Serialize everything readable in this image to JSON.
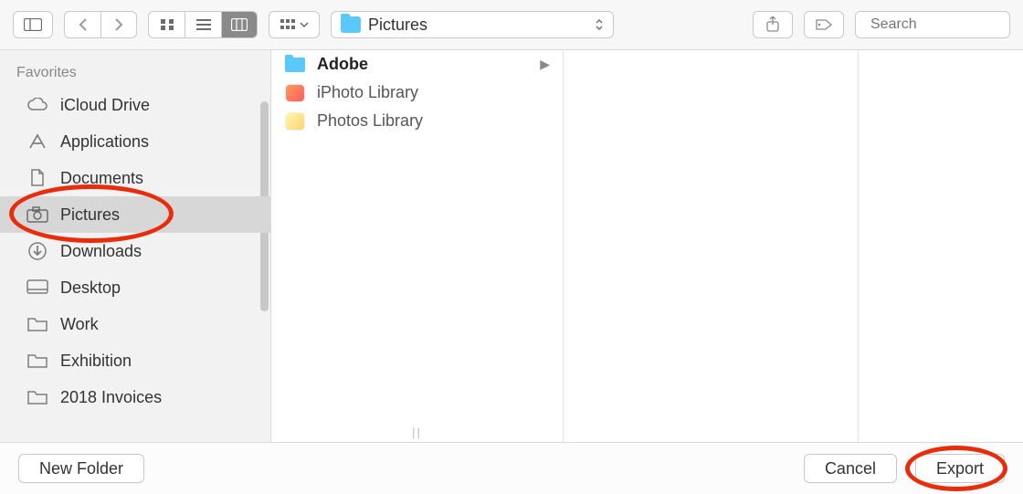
{
  "toolbar": {
    "current_folder": "Pictures",
    "search_placeholder": "Search"
  },
  "sidebar": {
    "heading": "Favorites",
    "items": [
      {
        "label": "iCloud Drive",
        "icon": "cloud"
      },
      {
        "label": "Applications",
        "icon": "apps"
      },
      {
        "label": "Documents",
        "icon": "doc"
      },
      {
        "label": "Pictures",
        "icon": "camera",
        "selected": true
      },
      {
        "label": "Downloads",
        "icon": "download"
      },
      {
        "label": "Desktop",
        "icon": "desktop"
      },
      {
        "label": "Work",
        "icon": "folder"
      },
      {
        "label": "Exhibition",
        "icon": "folder"
      },
      {
        "label": "2018 Invoices",
        "icon": "folder"
      }
    ]
  },
  "column0": {
    "items": [
      {
        "label": "Adobe",
        "kind": "folder"
      },
      {
        "label": "iPhoto Library",
        "kind": "app-orange"
      },
      {
        "label": "Photos Library",
        "kind": "app-yellow"
      }
    ]
  },
  "footer": {
    "new_folder": "New Folder",
    "cancel": "Cancel",
    "export": "Export"
  }
}
